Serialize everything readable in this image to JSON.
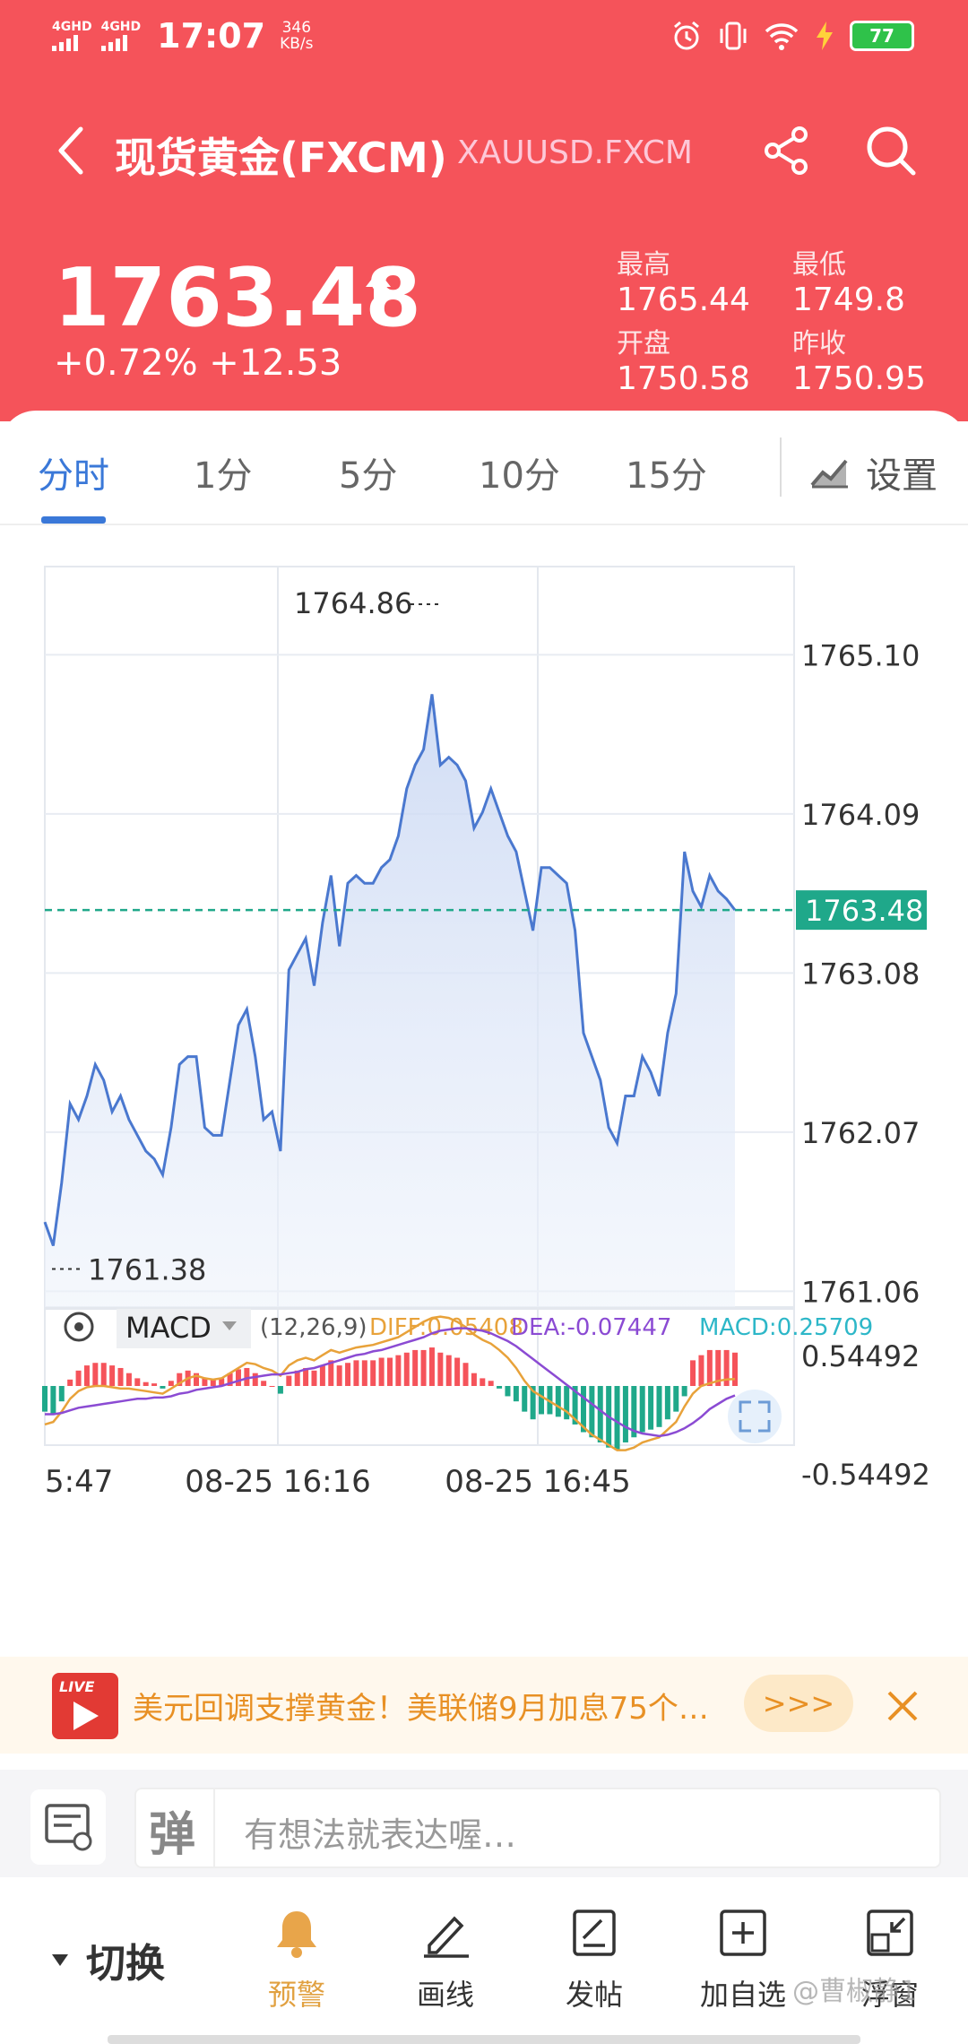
{
  "status_bar": {
    "net1": "4GHD",
    "net2": "4GHD",
    "time": "17:07",
    "speed_value": "346",
    "speed_unit": "KB/s",
    "battery": "77",
    "icons": [
      "alarm-icon",
      "vibrate-icon",
      "wifi-icon",
      "charging-icon",
      "battery-icon"
    ]
  },
  "header": {
    "title": "现货黄金(FXCM)",
    "code": "XAUUSD.FXCM",
    "icons": [
      "back-icon",
      "share-icon",
      "search-icon"
    ]
  },
  "quote": {
    "price": "1763.48",
    "change": "+0.72%  +12.53",
    "high_label": "最高",
    "high": "1765.44",
    "low_label": "最低",
    "low": "1749.8",
    "open_label": "开盘",
    "open": "1750.58",
    "prev_close_label": "昨收",
    "prev_close": "1750.95",
    "trend_icon": "up-arrow-icon"
  },
  "tabs": {
    "items": [
      "分时",
      "1分",
      "5分",
      "10分",
      "15分"
    ],
    "active": "分时",
    "settings_label": "设置"
  },
  "colors": {
    "rise": "#f5535a",
    "fall": "#1fa88a",
    "accent": "#3a78d8",
    "line": "#4a78cf",
    "diff_line": "#e8a23a",
    "dea_line": "#8b4bd3"
  },
  "chart_data": [
    {
      "type": "area",
      "title": "",
      "y_ticks": [
        "1765.10",
        "1764.09",
        "1763.08",
        "1762.07",
        "1761.06"
      ],
      "ylim": [
        1760.96,
        1765.66
      ],
      "x_ticks": [
        "5:47",
        "08-25 16:16",
        "08-25 16:45"
      ],
      "current_price_label": "1763.48",
      "current_price": 1763.48,
      "max_label": "1764.86",
      "min_label": "1761.38",
      "series": [
        {
          "values": [
            1761.5,
            1761.35,
            1761.75,
            1762.25,
            1762.15,
            1762.3,
            1762.5,
            1762.4,
            1762.2,
            1762.3,
            1762.15,
            1762.05,
            1761.95,
            1761.9,
            1761.8,
            1762.1,
            1762.5,
            1762.55,
            1762.55,
            1762.1,
            1762.05,
            1762.05,
            1762.4,
            1762.75,
            1762.85,
            1762.55,
            1762.15,
            1762.2,
            1761.95,
            1763.1,
            1763.2,
            1763.3,
            1763.0,
            1763.4,
            1763.7,
            1763.25,
            1763.65,
            1763.7,
            1763.65,
            1763.65,
            1763.75,
            1763.8,
            1763.95,
            1764.25,
            1764.4,
            1764.5,
            1764.85,
            1764.4,
            1764.45,
            1764.4,
            1764.3,
            1764.0,
            1764.1,
            1764.25,
            1764.1,
            1763.95,
            1763.85,
            1763.6,
            1763.35,
            1763.75,
            1763.75,
            1763.7,
            1763.65,
            1763.35,
            1762.7,
            1762.55,
            1762.4,
            1762.1,
            1762.0,
            1762.3,
            1762.3,
            1762.55,
            1762.45,
            1762.3,
            1762.7,
            1762.95,
            1763.85,
            1763.6,
            1763.5,
            1763.7,
            1763.6,
            1763.55,
            1763.48
          ]
        }
      ]
    },
    {
      "type": "bar",
      "title": "",
      "indicator": "MACD",
      "params": "(12,26,9)",
      "diff_label": "DIFF:0.05408",
      "dea_label": "DEA:-0.07447",
      "macd_label": "MACD:0.25709",
      "y_ticks": [
        "0.54492",
        "-0.54492"
      ],
      "ylim": [
        -0.54492,
        0.54492
      ],
      "series": [
        {
          "name": "MACD",
          "values": [
            -0.2,
            -0.22,
            -0.12,
            0.05,
            0.12,
            0.16,
            0.18,
            0.18,
            0.16,
            0.14,
            0.1,
            0.06,
            0.03,
            0.02,
            -0.02,
            0.04,
            0.1,
            0.12,
            0.1,
            0.06,
            0.05,
            0.06,
            0.1,
            0.13,
            0.14,
            0.1,
            0.04,
            0.0,
            -0.06,
            0.08,
            0.12,
            0.14,
            0.12,
            0.16,
            0.2,
            0.16,
            0.18,
            0.2,
            0.2,
            0.2,
            0.22,
            0.22,
            0.24,
            0.26,
            0.28,
            0.28,
            0.3,
            0.26,
            0.24,
            0.22,
            0.18,
            0.1,
            0.06,
            0.04,
            -0.02,
            -0.08,
            -0.12,
            -0.2,
            -0.26,
            -0.22,
            -0.22,
            -0.24,
            -0.26,
            -0.3,
            -0.36,
            -0.4,
            -0.44,
            -0.48,
            -0.5,
            -0.44,
            -0.4,
            -0.36,
            -0.34,
            -0.32,
            -0.26,
            -0.2,
            -0.08,
            0.2,
            0.24,
            0.28,
            0.28,
            0.28,
            0.26
          ]
        },
        {
          "name": "DIFF",
          "values": [
            -0.3,
            -0.28,
            -0.2,
            -0.1,
            -0.04,
            -0.01,
            0.0,
            0.0,
            -0.01,
            -0.02,
            -0.02,
            -0.03,
            -0.04,
            -0.05,
            -0.06,
            -0.02,
            0.02,
            0.06,
            0.08,
            0.06,
            0.05,
            0.06,
            0.1,
            0.14,
            0.18,
            0.17,
            0.14,
            0.12,
            0.08,
            0.16,
            0.2,
            0.22,
            0.2,
            0.24,
            0.28,
            0.26,
            0.28,
            0.3,
            0.31,
            0.32,
            0.34,
            0.36,
            0.38,
            0.42,
            0.46,
            0.5,
            0.53,
            0.54,
            0.53,
            0.5,
            0.46,
            0.4,
            0.36,
            0.33,
            0.28,
            0.22,
            0.14,
            0.04,
            -0.04,
            -0.08,
            -0.12,
            -0.16,
            -0.2,
            -0.26,
            -0.32,
            -0.38,
            -0.42,
            -0.46,
            -0.5,
            -0.5,
            -0.48,
            -0.44,
            -0.42,
            -0.4,
            -0.34,
            -0.28,
            -0.16,
            -0.06,
            0.0,
            0.02,
            0.04,
            0.05,
            0.054
          ]
        },
        {
          "name": "DEA",
          "values": [
            -0.22,
            -0.22,
            -0.21,
            -0.19,
            -0.17,
            -0.16,
            -0.15,
            -0.14,
            -0.13,
            -0.12,
            -0.11,
            -0.1,
            -0.1,
            -0.09,
            -0.09,
            -0.08,
            -0.06,
            -0.05,
            -0.03,
            -0.02,
            -0.01,
            0.0,
            0.02,
            0.04,
            0.06,
            0.07,
            0.08,
            0.09,
            0.09,
            0.1,
            0.11,
            0.13,
            0.14,
            0.16,
            0.18,
            0.2,
            0.22,
            0.24,
            0.25,
            0.27,
            0.28,
            0.3,
            0.32,
            0.34,
            0.36,
            0.38,
            0.41,
            0.43,
            0.44,
            0.45,
            0.45,
            0.44,
            0.43,
            0.41,
            0.38,
            0.35,
            0.31,
            0.26,
            0.21,
            0.16,
            0.11,
            0.06,
            0.01,
            -0.04,
            -0.09,
            -0.14,
            -0.19,
            -0.24,
            -0.28,
            -0.32,
            -0.35,
            -0.37,
            -0.38,
            -0.39,
            -0.38,
            -0.36,
            -0.33,
            -0.29,
            -0.24,
            -0.18,
            -0.14,
            -0.1,
            -0.074
          ]
        }
      ]
    }
  ],
  "news": {
    "badge": "LIVE",
    "headline": "美元回调支撑黄金！美联储9月加息75个…",
    "more": ">>>"
  },
  "comment": {
    "placeholder": "有想法就表达喔…"
  },
  "toolbar": {
    "switch_label": "切换",
    "items": [
      "预警",
      "画线",
      "发帖",
      "加自选",
      "浮窗"
    ],
    "active": "预警"
  },
  "watermark": "@曹椒静1"
}
